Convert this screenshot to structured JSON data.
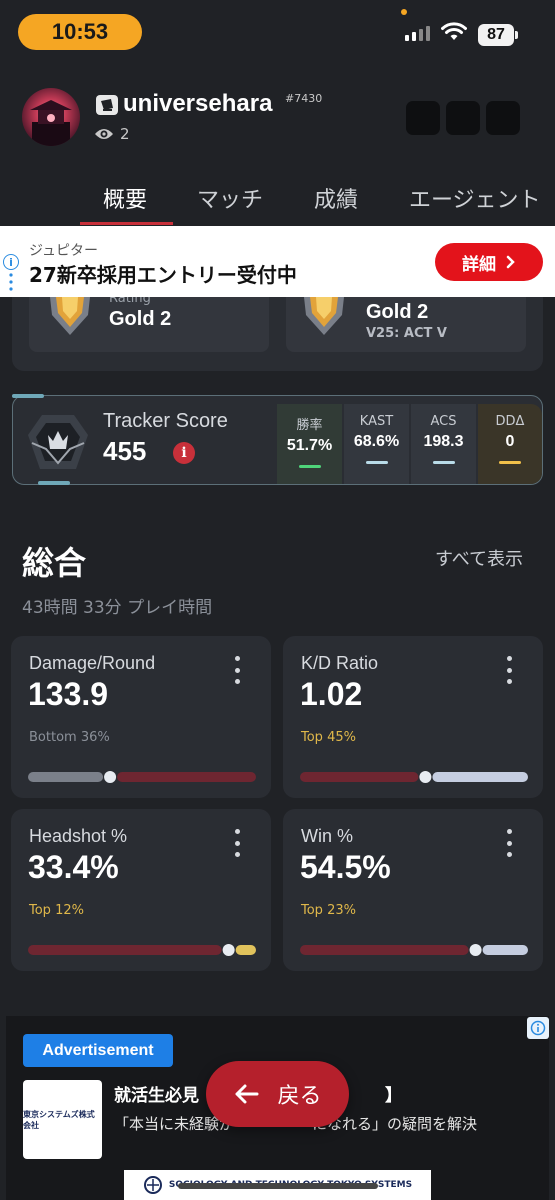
{
  "status": {
    "time": "10:53",
    "battery": "87"
  },
  "profile": {
    "username": "universehara",
    "tag": "#7430",
    "views": "2"
  },
  "tabs": [
    "概要",
    "マッチ",
    "成績",
    "エージェント"
  ],
  "ad_banner": {
    "brand": "ジュピター",
    "title": "27新卒採用エントリー受付中",
    "cta": "詳細"
  },
  "ranks": [
    {
      "sub": "Rating",
      "value": "Gold 2",
      "act": ""
    },
    {
      "sub": "",
      "value": "Gold 2",
      "act": "V25: ACT V"
    }
  ],
  "tracker": {
    "label": "Tracker Score",
    "score": "455",
    "stats": [
      {
        "label": "勝率",
        "value": "51.7%",
        "color": "#4fd47a"
      },
      {
        "label": "KAST",
        "value": "68.6%",
        "color": "#b9dbe8"
      },
      {
        "label": "ACS",
        "value": "198.3",
        "color": "#b9dbe8"
      },
      {
        "label": "DDΔ",
        "value": "0",
        "color": "#f2c04a"
      }
    ]
  },
  "overview": {
    "title": "総合",
    "view_all": "すべて表示",
    "playtime": "43時間 33分 プレイ時間",
    "cards": [
      {
        "title": "Damage/Round",
        "value": "133.9",
        "percentile": "Bottom 36%",
        "percentile_color": "#8b9099",
        "position": 0.36,
        "left_color": "#7b808a",
        "right_color": "#6e2631"
      },
      {
        "title": "K/D Ratio",
        "value": "1.02",
        "percentile": "Top 45%",
        "percentile_color": "#e0b84a",
        "position": 0.55,
        "left_color": "#6e2631",
        "right_color": "#c5cde0"
      },
      {
        "title": "Headshot %",
        "value": "33.4%",
        "percentile": "Top 12%",
        "percentile_color": "#e0b84a",
        "position": 0.88,
        "left_color": "#6e2631",
        "right_color": "#e0c25c"
      },
      {
        "title": "Win %",
        "value": "54.5%",
        "percentile": "Top 23%",
        "percentile_color": "#e0b84a",
        "position": 0.77,
        "left_color": "#6e2631",
        "right_color": "#c5cde0"
      }
    ]
  },
  "ad_bottom": {
    "tag": "Advertisement",
    "headline": "就活生必見",
    "headline_end": "】",
    "copy_start": "「本当に未経験が",
    "copy_end": "になれる」の疑問を解決",
    "logo_text": "東京システムズ株式会社",
    "company_en": "SOCIOLOGY AND TECHNOLOGY TOKYO SYSTEMS"
  },
  "back_button": "戻る"
}
